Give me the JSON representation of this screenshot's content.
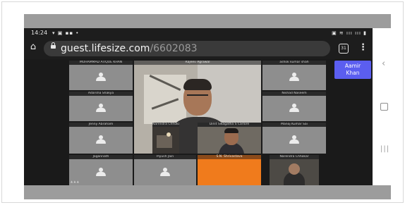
{
  "status_bar": {
    "time": "14:24",
    "left_icons": "▾ ▣ ▪▪ •",
    "right_icons": "▣ ≋ ııı ııı ▮"
  },
  "browser": {
    "url_domain": "guest.lifesize.com",
    "url_path": "/6602083",
    "tab_count": "31",
    "menu_icon": "kebab-menu-icon"
  },
  "participant_button": {
    "line1": "Aamir",
    "line2": "Khan"
  },
  "tiles": [
    {
      "name": "MOHAMMAD ATIQUE KHAN"
    },
    {
      "name": "Rajeev Agrawal"
    },
    {
      "name": "Adarsha Shakya"
    },
    {
      "name": "Nishad Naseem"
    },
    {
      "name": "Jenny Abraham"
    },
    {
      "name": "Narendra Chhokar"
    },
    {
      "name": "Dinit Swagatha S Carlore"
    },
    {
      "name": "Manoj Kumar Sai"
    },
    {
      "name": "Jagannath"
    },
    {
      "name": "Piyush Jain"
    },
    {
      "name": "S.N. Shrivastava"
    },
    {
      "name": "Narendra Chhokar"
    },
    {
      "name": "ashok kumar shah"
    }
  ],
  "footer_text": "▲ ▲ ▲",
  "colors": {
    "accent": "#5b5ef0",
    "orange_tile": "#f07b1c",
    "background": "#1d1d1d"
  }
}
